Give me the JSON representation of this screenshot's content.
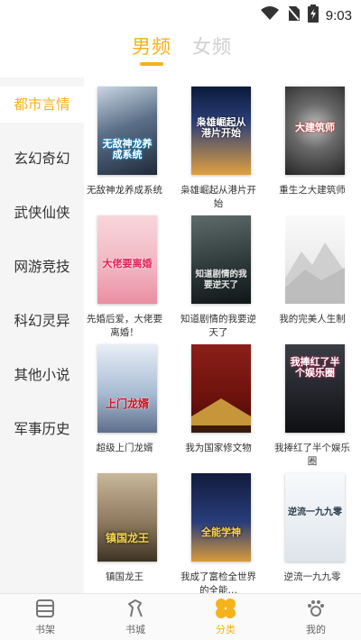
{
  "status": {
    "time": "9:03",
    "icons": [
      "wifi-icon",
      "no-sim-icon",
      "battery-charging-icon"
    ]
  },
  "tabs": {
    "male": "男频",
    "female": "女频",
    "active_color": "#f5b21b"
  },
  "sidebar": {
    "items": [
      {
        "label": "都市言情",
        "active": true
      },
      {
        "label": "玄幻奇幻"
      },
      {
        "label": "武侠仙侠"
      },
      {
        "label": "网游竞技"
      },
      {
        "label": "科幻灵异"
      },
      {
        "label": "其他小说"
      },
      {
        "label": "军事历史"
      }
    ]
  },
  "books": [
    {
      "title": "无敌神龙养成系统",
      "cover_text": "无敌神龙养成系统"
    },
    {
      "title": "枭雄崛起从港片开始",
      "cover_text": "枭雄崛起从港片开始"
    },
    {
      "title": "重生之大建筑师",
      "cover_text": "大建筑师"
    },
    {
      "title": "先婚后爱，大佬要离婚！",
      "cover_text": "大佬要离婚"
    },
    {
      "title": "知道剧情的我要逆天了",
      "cover_text": "知道剧情的我要逆天了"
    },
    {
      "title": "我的完美人生制",
      "cover_text": ""
    },
    {
      "title": "超级上门龙婿",
      "cover_text": "上门龙婿"
    },
    {
      "title": "我为国家修文物",
      "cover_text": ""
    },
    {
      "title": "我捧红了半个娱乐圈",
      "cover_text": "我捧红了半个娱乐圈"
    },
    {
      "title": "镇国龙王",
      "cover_text": "镇国龙王"
    },
    {
      "title": "我成了富检全世界的全能…",
      "cover_text": "全能学神"
    },
    {
      "title": "逆流一九九零",
      "cover_text": "逆流一九九零"
    }
  ],
  "nav": [
    {
      "label": "书架",
      "icon": "bookshelf-icon"
    },
    {
      "label": "书城",
      "icon": "bookstore-icon"
    },
    {
      "label": "分类",
      "icon": "category-icon",
      "active": true
    },
    {
      "label": "我的",
      "icon": "paw-profile-icon"
    }
  ]
}
